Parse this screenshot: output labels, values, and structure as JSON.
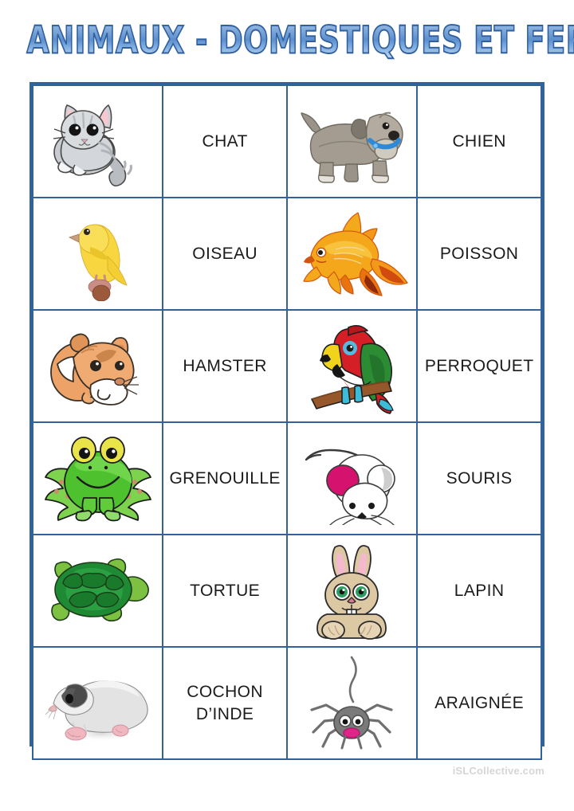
{
  "page": {
    "title": "ANIMAUX - DOMESTIQUES ET FERME",
    "watermark": "iSLCollective.com",
    "background_color": "#ffffff"
  },
  "theme": {
    "border_color": "#31629c",
    "title_fill_light": "#a9c6e8",
    "title_fill_dark": "#5d8fcd",
    "title_outline": "#2f5f9e",
    "word_color": "#1b1b1b",
    "watermark_color": "#d6d6d6"
  },
  "table": {
    "rows": 6,
    "columns": 4,
    "cells": [
      {
        "icon": "cat-illustration",
        "word": "CHAT",
        "icon2": "dog-illustration",
        "word2": "CHIEN"
      },
      {
        "icon": "canary-illustration",
        "word": "OISEAU",
        "icon2": "goldfish-illustration",
        "word2": "POISSON"
      },
      {
        "icon": "hamster-illustration",
        "word": "HAMSTER",
        "icon2": "parrot-illustration",
        "word2": "PERROQUET"
      },
      {
        "icon": "frog-illustration",
        "word": "GRENOUILLE",
        "icon2": "mouse-illustration",
        "word2": "SOURIS"
      },
      {
        "icon": "turtle-illustration",
        "word": "TORTUE",
        "icon2": "rabbit-illustration",
        "word2": "LAPIN"
      },
      {
        "icon": "guinea-pig-illustration",
        "word": "COCHON\nD’INDE",
        "icon2": "spider-illustration",
        "word2": "ARAIGNÉE"
      }
    ]
  }
}
